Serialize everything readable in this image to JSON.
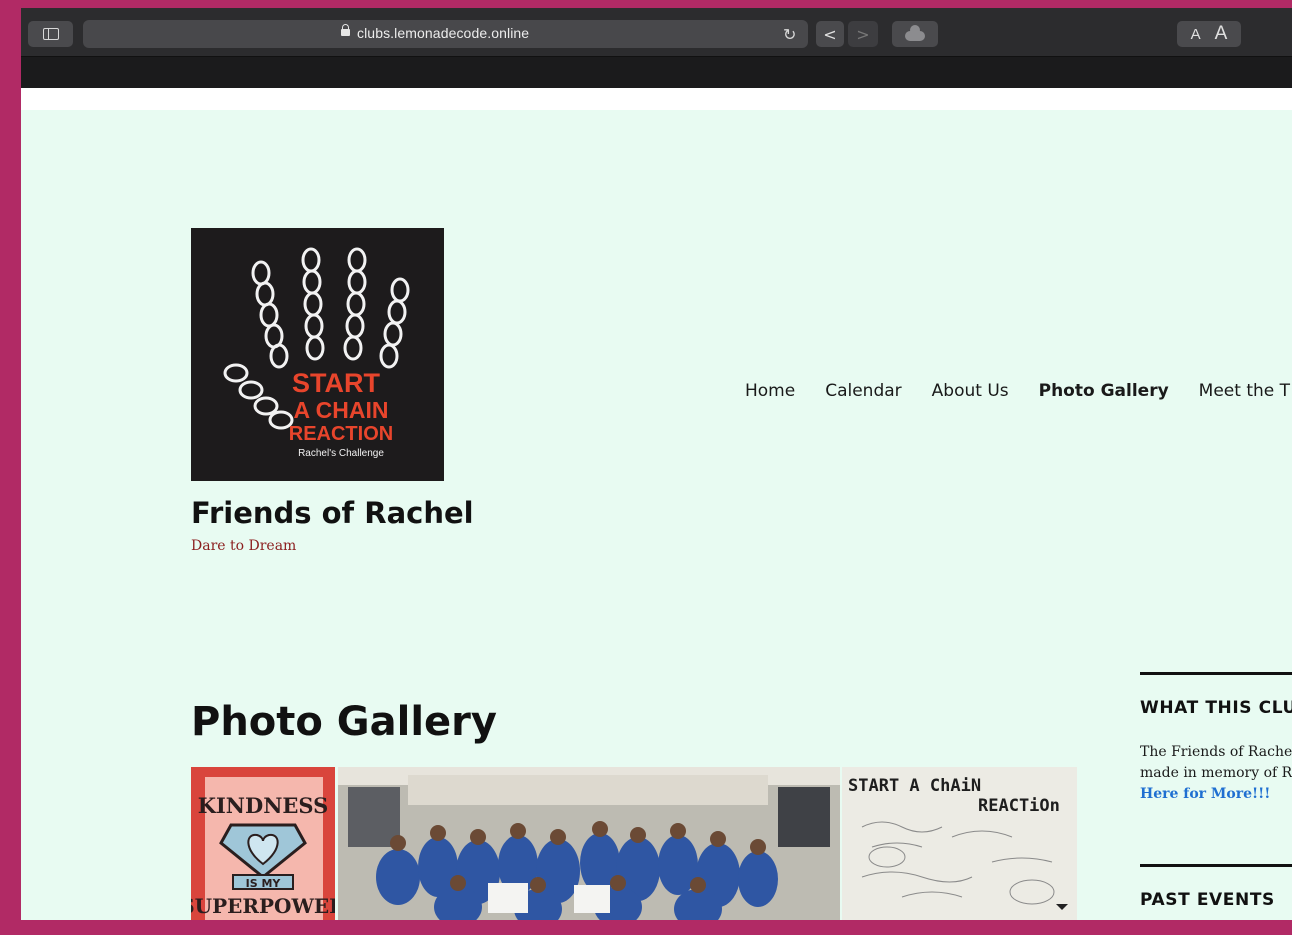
{
  "browser": {
    "url": "clubs.lemonadecode.online",
    "font_small_label": "A",
    "font_large_label": "A"
  },
  "site": {
    "title": "Friends of Rachel",
    "tagline": "Dare to Dream",
    "logo": {
      "line1": "START",
      "line2": "A CHAIN",
      "line3": "REACTION",
      "line4": "Rachel's Challenge"
    }
  },
  "nav": {
    "items": [
      {
        "label": "Home",
        "active": false
      },
      {
        "label": "Calendar",
        "active": false
      },
      {
        "label": "About Us",
        "active": false
      },
      {
        "label": "Photo Gallery",
        "active": true
      },
      {
        "label": "Meet the T",
        "active": false
      }
    ]
  },
  "main": {
    "page_title": "Photo Gallery",
    "gallery": {
      "photo1": {
        "line1": "KINDNESS",
        "line2": "IS MY",
        "line3": "SUPERPOWER"
      },
      "photo3": {
        "line1": "START A ChAiN",
        "line2": "REACTiOn"
      }
    }
  },
  "sidebar": {
    "widget1": {
      "title": "WHAT THIS CLU",
      "line1": "The Friends of Rachel c",
      "line2": "made in memory of Rac",
      "link": "Here for More!!!"
    },
    "widget2": {
      "title": "PAST EVENTS"
    }
  },
  "colors": {
    "outer_background": "#b12a65",
    "page_background": "#e8fbf2",
    "tagline": "#8b1e1e",
    "link": "#1f6fd1",
    "logo_accent": "#e8452c"
  }
}
